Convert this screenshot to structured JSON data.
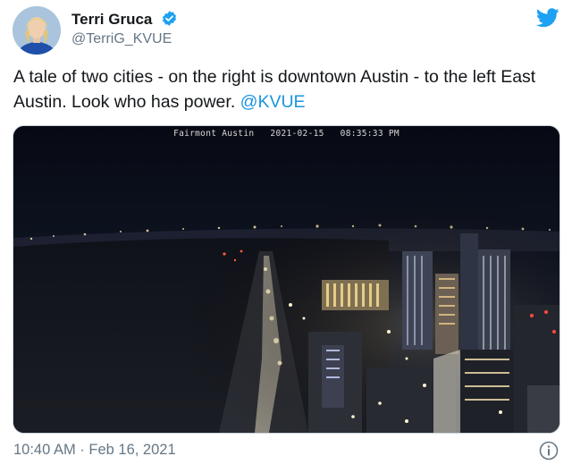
{
  "tweet": {
    "author_name": "Terri Gruca",
    "handle": "@TerriG_KVUE",
    "text_main": "A tale of two cities - on the right is downtown Austin - to the left East Austin. Look who has power.",
    "mention": "@KVUE",
    "timestamp": "10:40 AM · Feb 16, 2021"
  },
  "media": {
    "camera_caption": "Fairmont Austin   2021-02-15   08:35:33 PM"
  },
  "icons": {
    "verified": "verified-badge-icon",
    "twitter": "twitter-bird-icon",
    "info": "info-icon"
  },
  "colors": {
    "twitter_blue": "#1da1f2",
    "link_blue": "#1b95e0",
    "secondary_text": "#657786"
  }
}
